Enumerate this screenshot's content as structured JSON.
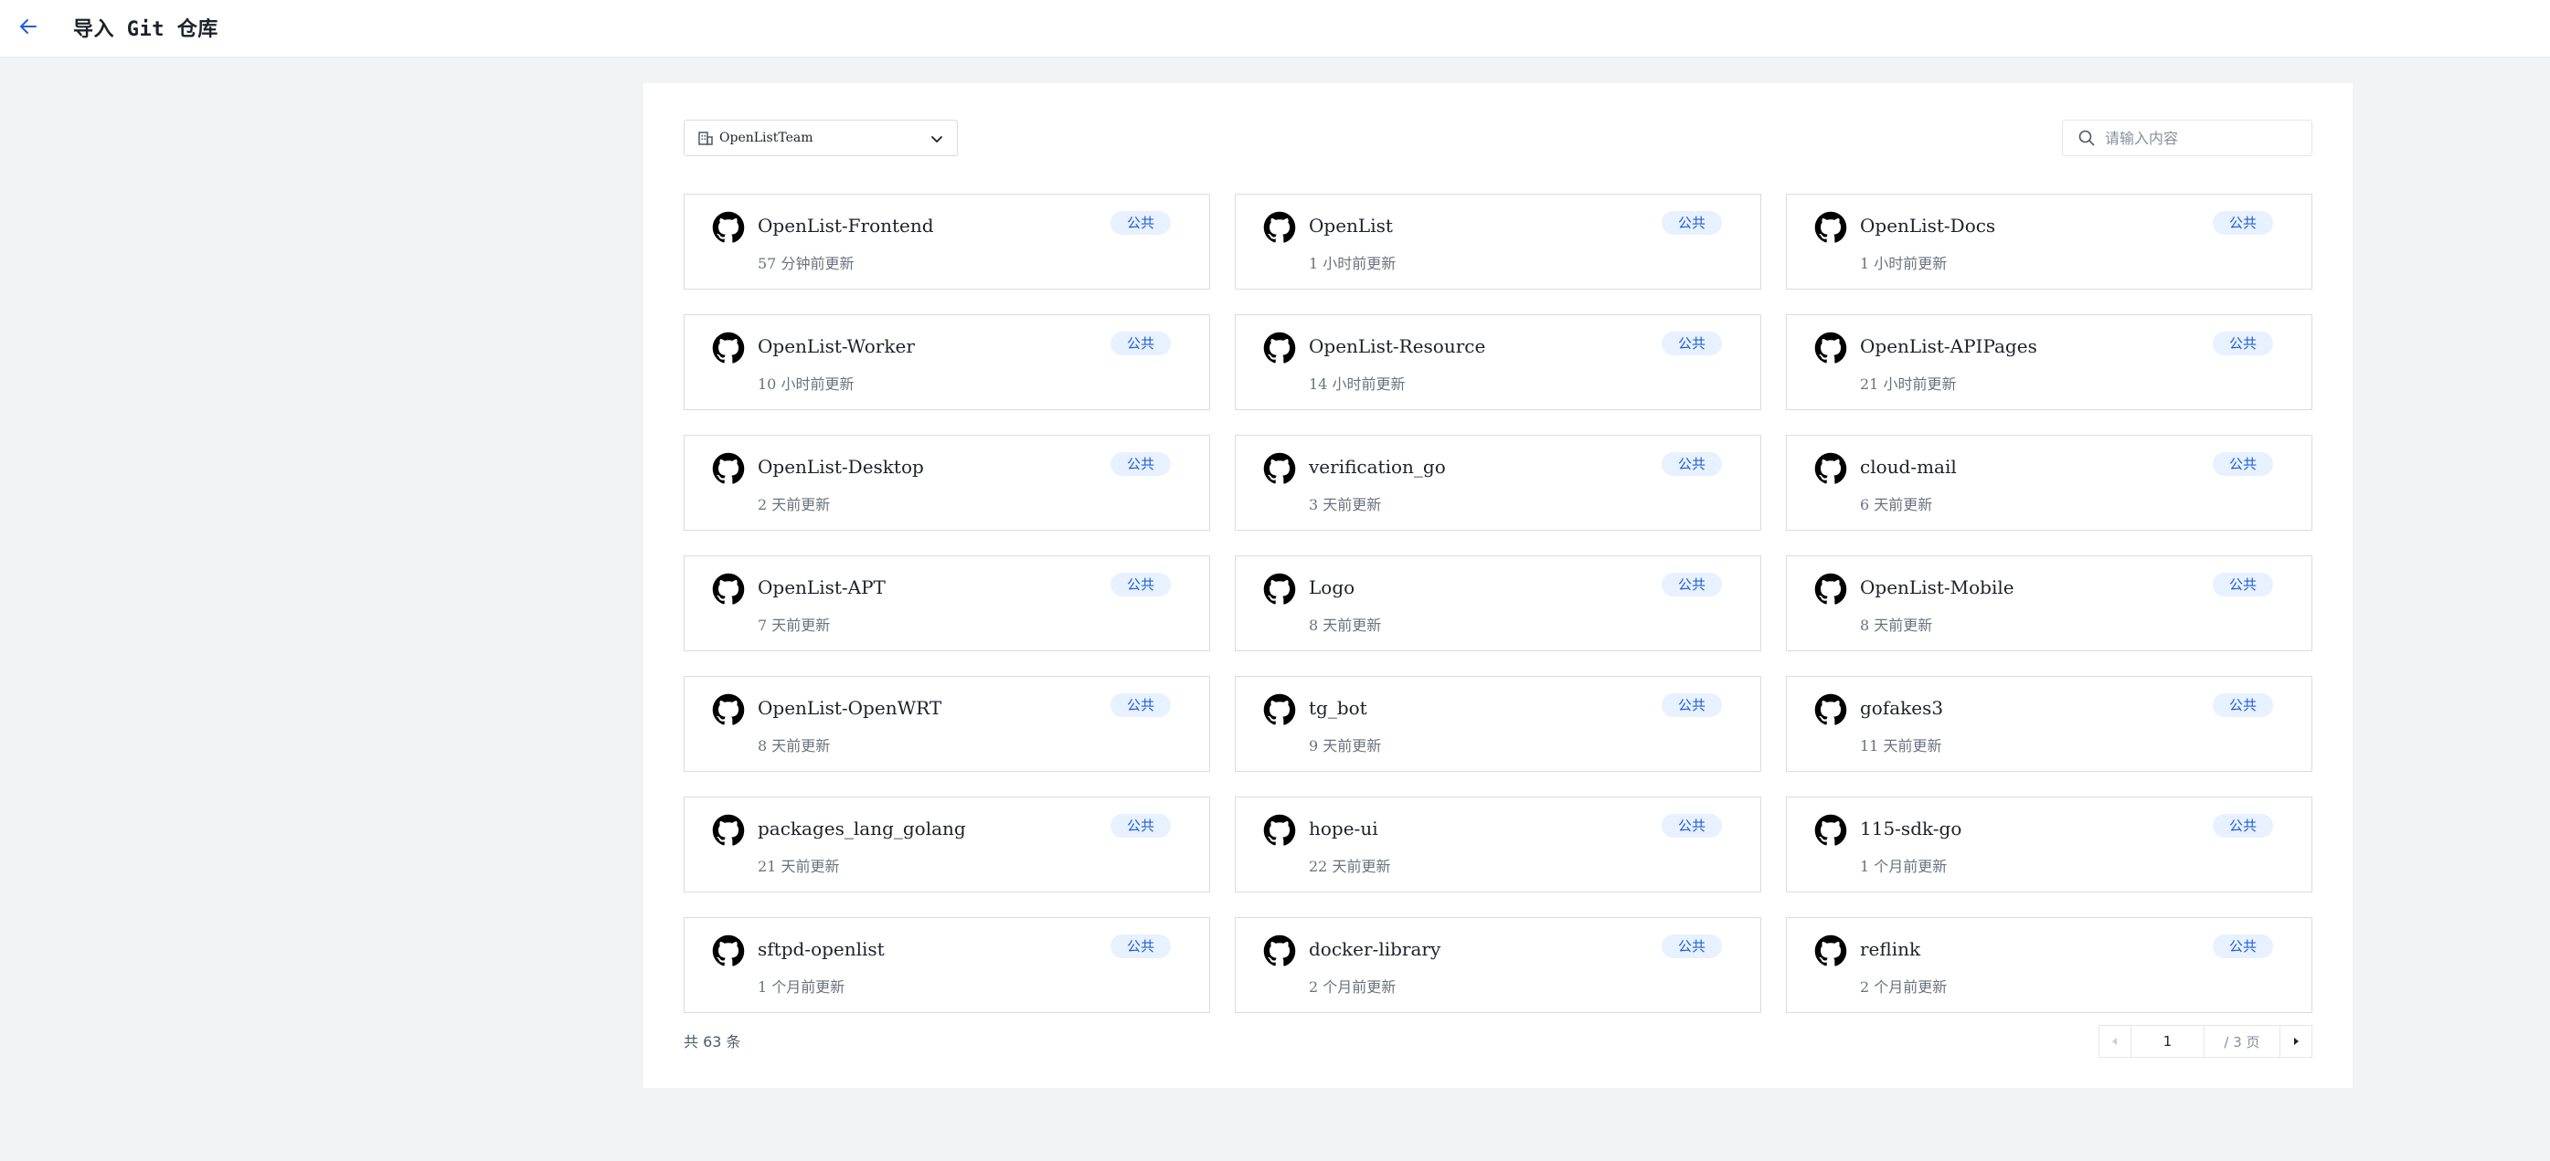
{
  "header": {
    "title": "导入 Git 仓库",
    "back_icon": "arrow-left-icon"
  },
  "org_select": {
    "value": "OpenListTeam",
    "icon": "building-icon",
    "chevron_icon": "chevron-down-icon"
  },
  "search": {
    "placeholder": "请输入内容",
    "value": "",
    "icon": "search-icon"
  },
  "colors": {
    "accent": "#1e5fd8",
    "badge_bg": "#e8f1ff"
  },
  "repos": [
    {
      "name": "OpenList-Frontend",
      "updated": "57 分钟前更新",
      "visibility": "公共"
    },
    {
      "name": "OpenList",
      "updated": "1 小时前更新",
      "visibility": "公共"
    },
    {
      "name": "OpenList-Docs",
      "updated": "1 小时前更新",
      "visibility": "公共"
    },
    {
      "name": "OpenList-Worker",
      "updated": "10 小时前更新",
      "visibility": "公共"
    },
    {
      "name": "OpenList-Resource",
      "updated": "14 小时前更新",
      "visibility": "公共"
    },
    {
      "name": "OpenList-APIPages",
      "updated": "21 小时前更新",
      "visibility": "公共"
    },
    {
      "name": "OpenList-Desktop",
      "updated": "2 天前更新",
      "visibility": "公共"
    },
    {
      "name": "verification_go",
      "updated": "3 天前更新",
      "visibility": "公共"
    },
    {
      "name": "cloud-mail",
      "updated": "6 天前更新",
      "visibility": "公共"
    },
    {
      "name": "OpenList-APT",
      "updated": "7 天前更新",
      "visibility": "公共"
    },
    {
      "name": "Logo",
      "updated": "8 天前更新",
      "visibility": "公共"
    },
    {
      "name": "OpenList-Mobile",
      "updated": "8 天前更新",
      "visibility": "公共"
    },
    {
      "name": "OpenList-OpenWRT",
      "updated": "8 天前更新",
      "visibility": "公共"
    },
    {
      "name": "tg_bot",
      "updated": "9 天前更新",
      "visibility": "公共"
    },
    {
      "name": "gofakes3",
      "updated": "11 天前更新",
      "visibility": "公共"
    },
    {
      "name": "packages_lang_golang",
      "updated": "21 天前更新",
      "visibility": "公共"
    },
    {
      "name": "hope-ui",
      "updated": "22 天前更新",
      "visibility": "公共"
    },
    {
      "name": "115-sdk-go",
      "updated": "1 个月前更新",
      "visibility": "公共"
    },
    {
      "name": "sftpd-openlist",
      "updated": "1 个月前更新",
      "visibility": "公共"
    },
    {
      "name": "docker-library",
      "updated": "2 个月前更新",
      "visibility": "公共"
    },
    {
      "name": "reflink",
      "updated": "2 个月前更新",
      "visibility": "公共"
    }
  ],
  "repo_icon": "github-icon",
  "footer": {
    "total_text": "共 63 条"
  },
  "pagination": {
    "current_page": "1",
    "total_text": "/ 3 页",
    "prev_icon": "caret-left-icon",
    "next_icon": "caret-right-icon"
  }
}
